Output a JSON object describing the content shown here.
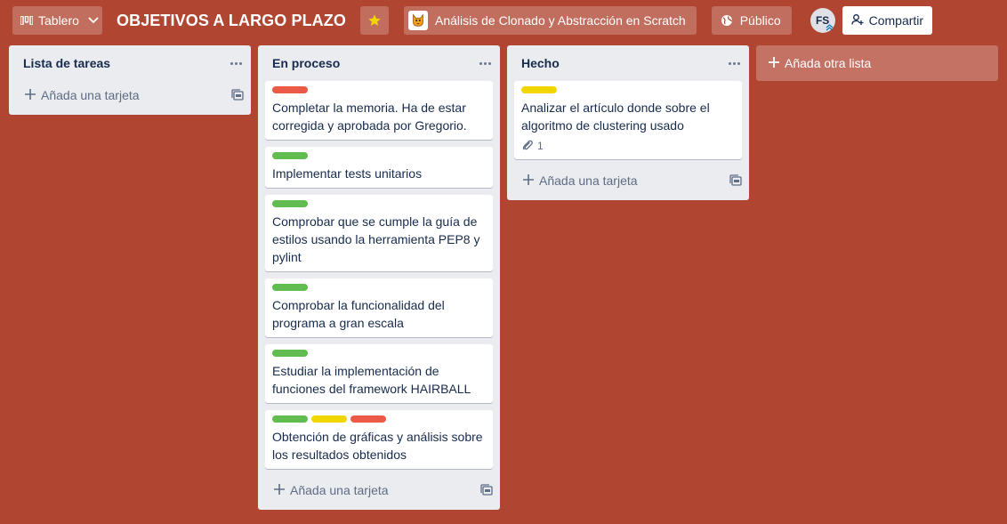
{
  "header": {
    "view_switch_label": "Tablero",
    "board_title": "OBJETIVOS A LARGO PLAZO",
    "team_label": "Análisis de Clonado y Abstracción en Scratch",
    "visibility_label": "Público",
    "member_initials": "FS",
    "share_label": "Compartir",
    "star_color": "#f2d600"
  },
  "lists": [
    {
      "title": "Lista de tareas",
      "cards": [],
      "add_card_label": "Añada una tarjeta"
    },
    {
      "title": "En proceso",
      "cards": [
        {
          "labels": [
            "#eb5a46"
          ],
          "text": "Completar la memoria. Ha de estar corregida y aprobada por Gregorio."
        },
        {
          "labels": [
            "#61bd4f"
          ],
          "text": "Implementar tests unitarios"
        },
        {
          "labels": [
            "#61bd4f"
          ],
          "text": "Comprobar que se cumple la guía de estilos usando la herramienta PEP8 y pylint"
        },
        {
          "labels": [
            "#61bd4f"
          ],
          "text": "Comprobar la funcionalidad del programa a gran escala"
        },
        {
          "labels": [
            "#61bd4f"
          ],
          "text": "Estudiar la implementación de funciones del framework HAIRBALL"
        },
        {
          "labels": [
            "#61bd4f",
            "#f2d600",
            "#eb5a46"
          ],
          "text": "Obtención de gráficas y análisis sobre los resultados obtenidos"
        }
      ],
      "add_card_label": "Añada una tarjeta"
    },
    {
      "title": "Hecho",
      "cards": [
        {
          "labels": [
            "#f2d600"
          ],
          "text": "Analizar el artículo donde sobre el algoritmo de clustering usado",
          "attachments": "1"
        }
      ],
      "add_card_label": "Añada una tarjeta"
    }
  ],
  "add_list_label": "Añada otra lista",
  "colors": {
    "board_background": "#b04632",
    "list_background": "#ebecf0",
    "label_green": "#61bd4f",
    "label_yellow": "#f2d600",
    "label_red": "#eb5a46"
  }
}
